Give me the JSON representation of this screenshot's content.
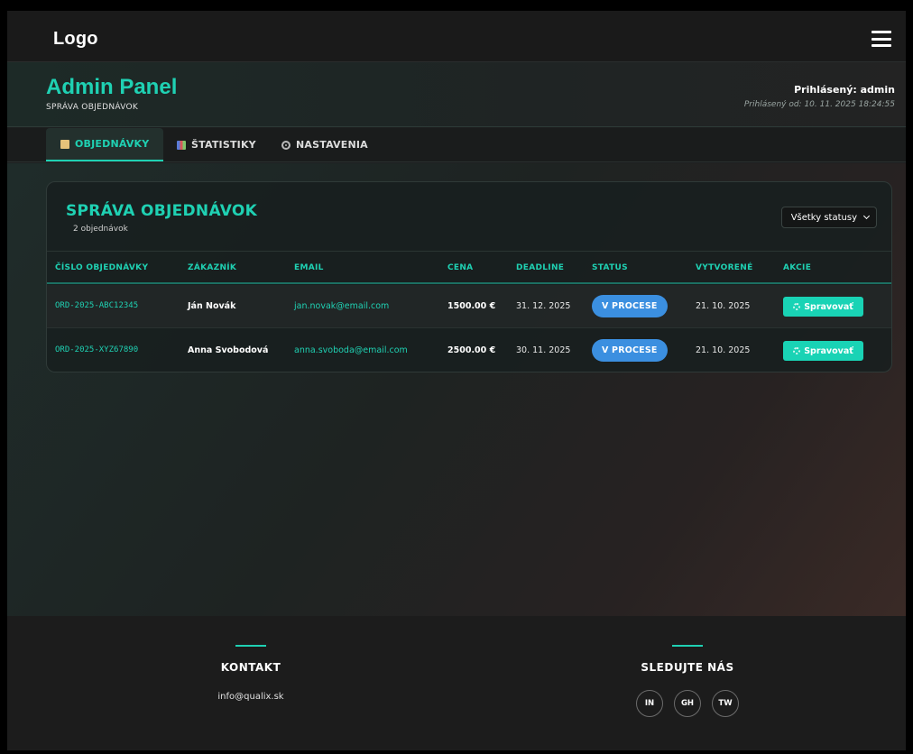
{
  "navbar": {
    "logo": "Logo"
  },
  "header": {
    "title": "Admin Panel",
    "subtitle": "SPRÁVA OBJEDNÁVOK",
    "logged_user": "Prihlásený: admin",
    "logged_since": "Prihlásený od: 10. 11. 2025 18:24:55"
  },
  "tabs": [
    {
      "label": "OBJEDNÁVKY",
      "icon": "clipboard-icon",
      "active": true
    },
    {
      "label": "ŠTATISTIKY",
      "icon": "bar-chart-icon",
      "active": false
    },
    {
      "label": "NASTAVENIA",
      "icon": "gear-icon",
      "active": false
    }
  ],
  "orders": {
    "title": "SPRÁVA OBJEDNÁVOK",
    "count": "2 objednávok",
    "filter": {
      "selected": "Všetky statusy"
    },
    "columns": [
      "ČÍSLO OBJEDNÁVKY",
      "ZÁKAZNÍK",
      "EMAIL",
      "CENA",
      "DEADLINE",
      "STATUS",
      "VYTVORENÉ",
      "AKCIE"
    ],
    "rows": [
      {
        "order_no": "ORD-2025-ABC12345",
        "customer": "Ján Novák",
        "email": "jan.novak@email.com",
        "price": "1500.00 €",
        "deadline": "31. 12. 2025",
        "status": "V PROCESE",
        "created": "21. 10. 2025",
        "action": "Spravovať"
      },
      {
        "order_no": "ORD-2025-XYZ67890",
        "customer": "Anna Svobodová",
        "email": "anna.svoboda@email.com",
        "price": "2500.00 €",
        "deadline": "30. 11. 2025",
        "status": "V PROCESE",
        "created": "21. 10. 2025",
        "action": "Spravovať"
      }
    ]
  },
  "footer": {
    "contact_title": "KONTAKT",
    "contact_email": "info@qualix.sk",
    "social_title": "SLEDUJTE NÁS",
    "socials": [
      "IN",
      "GH",
      "TW"
    ]
  },
  "colors": {
    "accent": "#1fd1b3",
    "status_badge": "#3b8fe0",
    "background": "#1d1f20"
  }
}
